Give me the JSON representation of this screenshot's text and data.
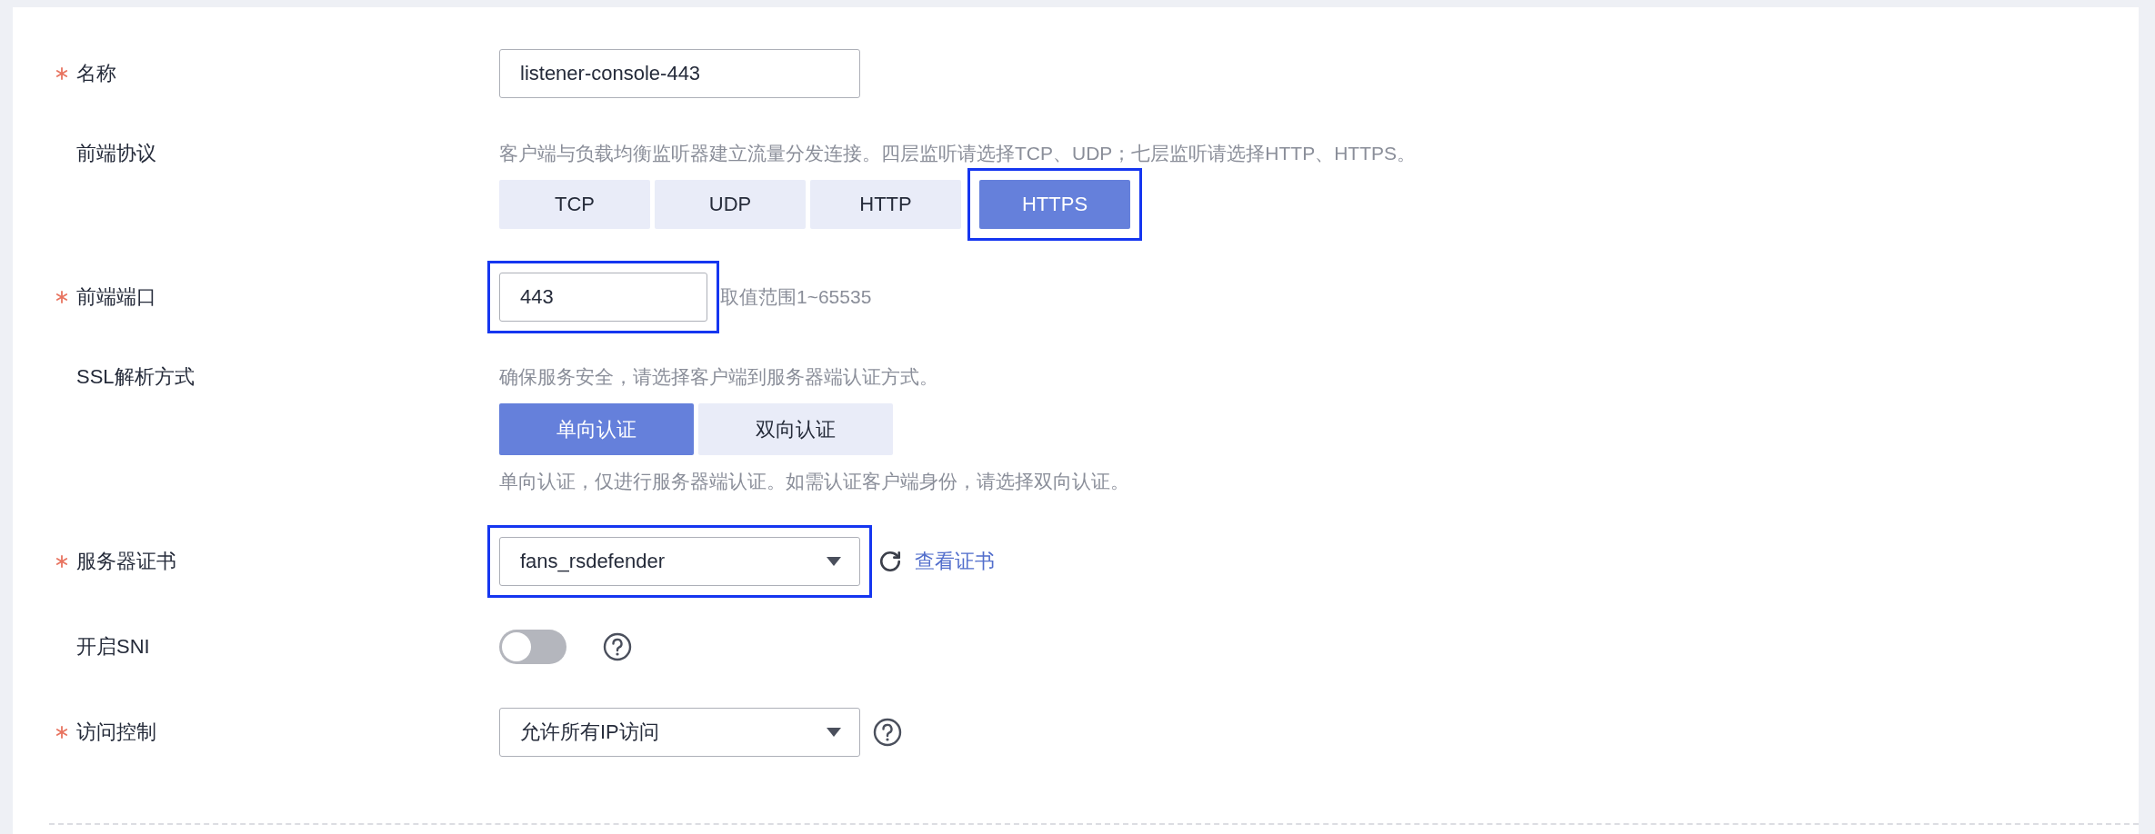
{
  "fields": [
    {
      "kind": "input",
      "required": true,
      "label": "名称",
      "value": "listener-console-443",
      "highlighted": false
    },
    {
      "kind": "segmented",
      "required": false,
      "label": "前端协议",
      "hint": "客户端与负载均衡监听器建立流量分发连接。四层监听请选择TCP、UDP；七层监听请选择HTTP、HTTPS。",
      "options": [
        {
          "label": "TCP",
          "selected": false,
          "highlighted": false
        },
        {
          "label": "UDP",
          "selected": false,
          "highlighted": false
        },
        {
          "label": "HTTP",
          "selected": false,
          "highlighted": false
        },
        {
          "label": "HTTPS",
          "selected": true,
          "highlighted": true
        }
      ]
    },
    {
      "kind": "input",
      "required": true,
      "label": "前端端口",
      "value": "443",
      "highlighted": true,
      "note": "取值范围1~65535"
    },
    {
      "kind": "segmented",
      "required": false,
      "label": "SSL解析方式",
      "hint": "确保服务安全，请选择客户端到服务器端认证方式。",
      "options": [
        {
          "label": "单向认证",
          "selected": true,
          "highlighted": false
        },
        {
          "label": "双向认证",
          "selected": false,
          "highlighted": false
        }
      ],
      "note": "单向认证，仅进行服务器端认证。如需认证客户端身份，请选择双向认证。"
    },
    {
      "kind": "select",
      "required": true,
      "label": "服务器证书",
      "value": "fans_rsdefender",
      "highlighted": true,
      "refresh": true,
      "link": "查看证书"
    },
    {
      "kind": "toggle",
      "required": false,
      "label": "开启SNI",
      "on": false,
      "help": true
    },
    {
      "kind": "select",
      "required": true,
      "label": "访问控制",
      "value": "允许所有IP访问",
      "highlighted": false,
      "help": true
    }
  ]
}
